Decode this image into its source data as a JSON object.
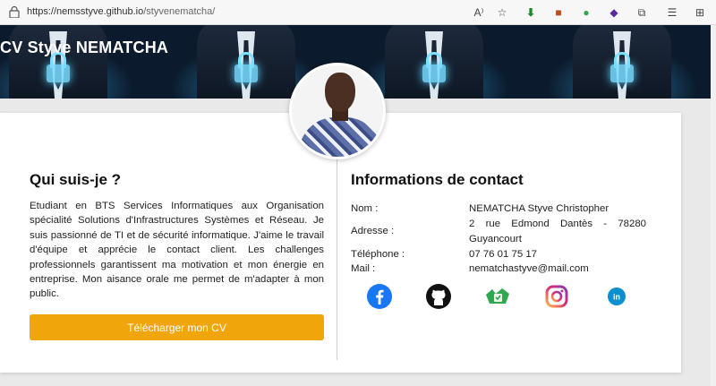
{
  "browser": {
    "url_host": "https://nemsstyve.github.io",
    "url_path": "/styvenematcha/"
  },
  "banner": {
    "title": "CV Styve NEMATCHA"
  },
  "about": {
    "heading": "Qui suis-je ?",
    "text": "Etudiant en BTS Services Informatiques aux Organisation spécialité Solutions d'Infrastructures Systèmes et Réseau. Je suis passionné de TI et de sécurité informatique. J'aime le travail d'équipe et apprécie le contact client. Les challenges professionnels garantissent ma motivation et mon énergie en entreprise. Mon aisance orale me permet de m'adapter à mon public.",
    "download_label": "Télécharger mon CV"
  },
  "contact": {
    "heading": "Informations de contact",
    "name_label": "Nom :",
    "name_value": "NEMATCHA Styve Christopher",
    "address_label": "Adresse :",
    "address_value": "2 rue Edmond Dantès - 78280 Guyancourt",
    "phone_label": "Téléphone :",
    "phone_value": "07 76 01 75 17",
    "mail_label": "Mail :",
    "mail_value": "nematchastyve@mail.com"
  },
  "social": [
    "facebook-icon",
    "github-icon",
    "gitlab-icon",
    "instagram-icon",
    "linkedin-icon"
  ],
  "colors": {
    "accent": "#f0a50a",
    "facebook": "#1877f2",
    "linkedin": "#0a8fd0"
  }
}
